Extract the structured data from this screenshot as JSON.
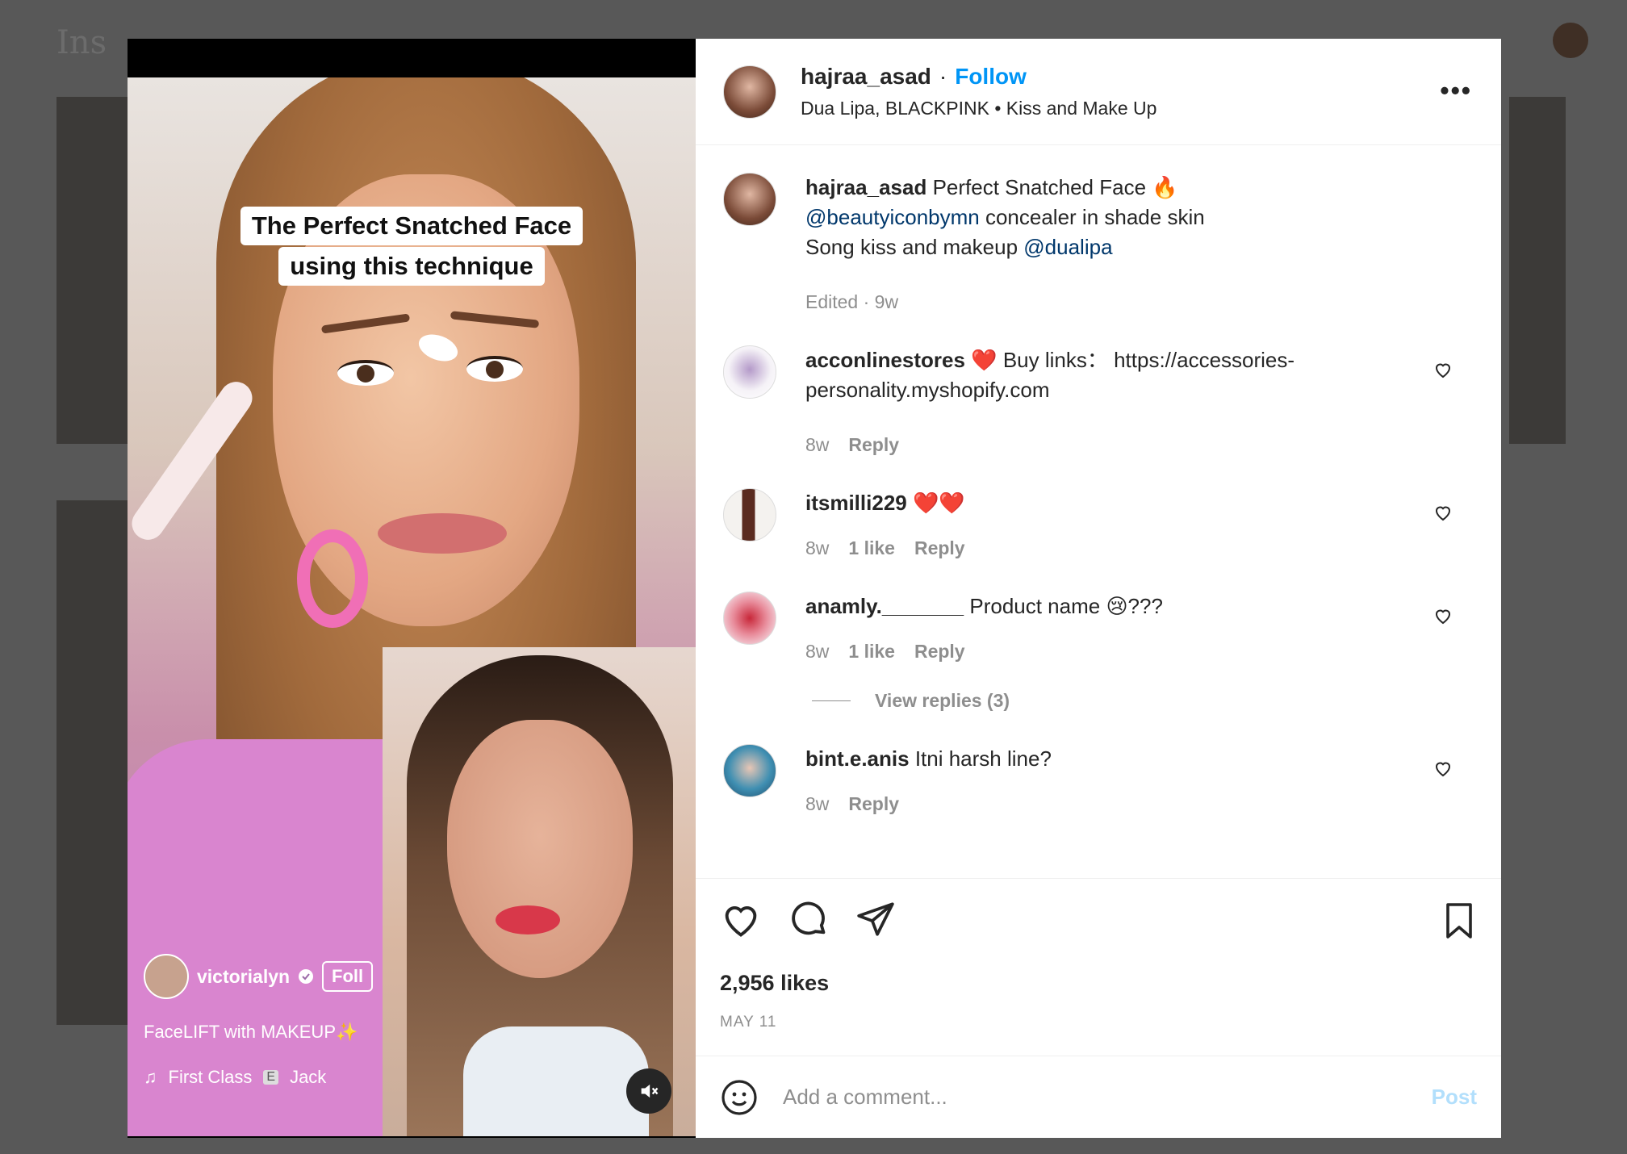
{
  "post": {
    "username": "hajraa_asad",
    "follow_label": "Follow",
    "audio_line": "Dua Lipa, BLACKPINK • Kiss and Make Up",
    "more_label": "•••",
    "caption_title": "Perfect Snatched Face 🔥",
    "caption_mention1": "@beautyiconbymn",
    "caption_after_mention1": " concealer in shade skin",
    "caption_line3_prefix": "Song kiss and makeup ",
    "caption_mention2": "@dualipa",
    "caption_meta": "Edited · 9w",
    "likes": "2,956 likes",
    "date": "MAY 11"
  },
  "video": {
    "caption_line1": "The Perfect Snatched Face",
    "caption_line2": "using this technique",
    "creator": "victorialyn",
    "creator_follow": "Foll",
    "reel_caption": "FaceLIFT with MAKEUP✨",
    "audio_track": "First Class",
    "audio_artist": "Jack",
    "explicit_badge": "E"
  },
  "comments": [
    {
      "user": "acconlinestores",
      "text": "❤️ Buy links： https://accessories-personality.myshopify.com",
      "time": "8w",
      "likes": "",
      "reply": "Reply"
    },
    {
      "user": "itsmilli229",
      "text": "❤️❤️",
      "time": "8w",
      "likes": "1 like",
      "reply": "Reply"
    },
    {
      "user": "anamly._______",
      "text": "Product name 😢???",
      "time": "8w",
      "likes": "1 like",
      "reply": "Reply"
    },
    {
      "user": "bint.e.anis",
      "text": "Itni harsh line?",
      "time": "8w",
      "likes": "",
      "reply": "Reply"
    }
  ],
  "view_replies": "View replies (3)",
  "add_comment": {
    "placeholder": "Add a comment...",
    "post_label": "Post"
  },
  "colors": {
    "accent": "#0095f6",
    "mention": "#00376b",
    "muted": "#8e8e8e",
    "post_disabled": "#b2dffc"
  },
  "icons": [
    "more-icon",
    "heart-icon",
    "comment-icon",
    "share-icon",
    "bookmark-icon",
    "emoji-icon",
    "mute-icon",
    "verified-icon",
    "music-icon"
  ]
}
